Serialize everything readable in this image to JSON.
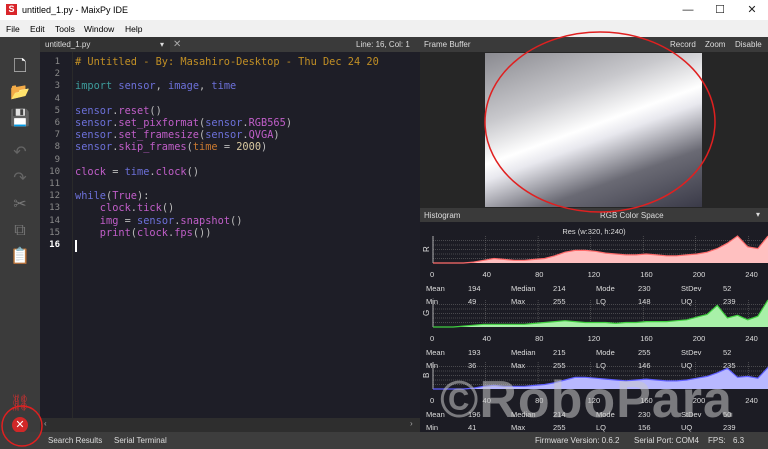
{
  "window": {
    "title": "untitled_1.py - MaixPy IDE",
    "logo": "S",
    "minimize": "—",
    "maximize": "☐",
    "close": "✕"
  },
  "menu": [
    "File",
    "Edit",
    "Tools",
    "Window",
    "Help"
  ],
  "editor": {
    "tab": "untitled_1.py",
    "position": "Line: 16, Col: 1",
    "lines": [
      [
        [
          "# Untitled - By: Masahiro-Desktop - Thu Dec 24 20",
          "cm"
        ]
      ],
      [],
      [
        [
          "import ",
          "kw"
        ],
        [
          "sensor",
          "id"
        ],
        [
          ", ",
          "p"
        ],
        [
          "image",
          "id"
        ],
        [
          ", ",
          "p"
        ],
        [
          "time",
          "id"
        ]
      ],
      [],
      [
        [
          "sensor",
          "id"
        ],
        [
          ".",
          "p"
        ],
        [
          "reset",
          "fn"
        ],
        [
          "()",
          "p"
        ]
      ],
      [
        [
          "sensor",
          "id"
        ],
        [
          ".",
          "p"
        ],
        [
          "set_pixformat",
          "fn"
        ],
        [
          "(",
          "p"
        ],
        [
          "sensor",
          "id"
        ],
        [
          ".",
          "p"
        ],
        [
          "RGB565",
          "fn"
        ],
        [
          ")",
          "p"
        ]
      ],
      [
        [
          "sensor",
          "id"
        ],
        [
          ".",
          "p"
        ],
        [
          "set_framesize",
          "fn"
        ],
        [
          "(",
          "p"
        ],
        [
          "sensor",
          "id"
        ],
        [
          ".",
          "p"
        ],
        [
          "QVGA",
          "fn"
        ],
        [
          ")",
          "p"
        ]
      ],
      [
        [
          "sensor",
          "id"
        ],
        [
          ".",
          "p"
        ],
        [
          "skip_frames",
          "fn"
        ],
        [
          "(",
          "p"
        ],
        [
          "time",
          "arg"
        ],
        [
          " = ",
          "p"
        ],
        [
          "2000",
          "nu"
        ],
        [
          ")",
          "p"
        ]
      ],
      [],
      [
        [
          "clock",
          "fn"
        ],
        [
          " = ",
          "p"
        ],
        [
          "time",
          "id"
        ],
        [
          ".",
          "p"
        ],
        [
          "clock",
          "fn"
        ],
        [
          "()",
          "p"
        ]
      ],
      [],
      [
        [
          "while",
          "id"
        ],
        [
          "(",
          "p"
        ],
        [
          "True",
          "tr"
        ],
        [
          "):",
          "p"
        ]
      ],
      [
        [
          "    clock",
          "fn"
        ],
        [
          ".",
          "p"
        ],
        [
          "tick",
          "fn"
        ],
        [
          "()",
          "p"
        ]
      ],
      [
        [
          "    img",
          "fn"
        ],
        [
          " = ",
          "p"
        ],
        [
          "sensor",
          "id"
        ],
        [
          ".",
          "p"
        ],
        [
          "snapshot",
          "fn"
        ],
        [
          "()",
          "p"
        ]
      ],
      [
        [
          "    print",
          "fn"
        ],
        [
          "(",
          "p"
        ],
        [
          "clock",
          "fn"
        ],
        [
          ".",
          "p"
        ],
        [
          "fps",
          "fn"
        ],
        [
          "())",
          "p"
        ]
      ],
      []
    ]
  },
  "framebuffer": {
    "title": "Frame Buffer",
    "record": "Record",
    "zoom": "Zoom",
    "disable": "Disable"
  },
  "histogram": {
    "title": "Histogram",
    "colorspace": "RGB Color Space",
    "res": "Res (w:320, h:240)",
    "ticks": [
      "0",
      "40",
      "80",
      "120",
      "160",
      "200",
      "240"
    ],
    "channels": [
      {
        "label": "R",
        "color": "#ff6b6b",
        "fill": "#ffc0c0",
        "stats": {
          "Mean": "194",
          "Median": "214",
          "Mode": "230",
          "StDev": "52",
          "Min": "49",
          "Max": "255",
          "LQ": "148",
          "UQ": "239"
        },
        "curve": [
          0,
          0,
          0,
          0,
          1,
          3,
          5,
          4,
          3,
          3,
          4,
          5,
          8,
          12,
          14,
          14,
          13,
          11,
          10,
          9,
          9,
          10,
          9,
          8,
          8,
          9,
          10,
          12,
          16,
          22,
          30,
          18,
          16,
          30
        ]
      },
      {
        "label": "G",
        "color": "#40d040",
        "fill": "#a8f0a8",
        "stats": {
          "Mean": "193",
          "Median": "215",
          "Mode": "255",
          "StDev": "52",
          "Min": "36",
          "Max": "255",
          "LQ": "146",
          "UQ": "235"
        },
        "curve": [
          0,
          0,
          0,
          1,
          2,
          3,
          3,
          3,
          3,
          3,
          4,
          5,
          6,
          7,
          6,
          5,
          5,
          5,
          4,
          5,
          5,
          6,
          6,
          6,
          7,
          8,
          11,
          14,
          24,
          10,
          13,
          8,
          12,
          30
        ]
      },
      {
        "label": "B",
        "color": "#6060ff",
        "fill": "#b8b8ff",
        "stats": {
          "Mean": "196",
          "Median": "214",
          "Mode": "230",
          "StDev": "50",
          "Min": "41",
          "Max": "255",
          "LQ": "156",
          "UQ": "239"
        },
        "curve": [
          0,
          0,
          0,
          0,
          1,
          3,
          4,
          3,
          3,
          3,
          4,
          5,
          7,
          10,
          13,
          13,
          12,
          11,
          10,
          9,
          10,
          11,
          10,
          9,
          9,
          10,
          12,
          14,
          18,
          23,
          13,
          14,
          12,
          24
        ]
      }
    ]
  },
  "status": {
    "search": "Search Results",
    "serial": "Serial Terminal",
    "firmware": "Firmware Version: 0.6.2",
    "port": "Serial Port: COM4",
    "fps_label": "FPS:",
    "fps": "6.3"
  },
  "watermark": "©RoboPara",
  "annotation_color": "#e02020"
}
